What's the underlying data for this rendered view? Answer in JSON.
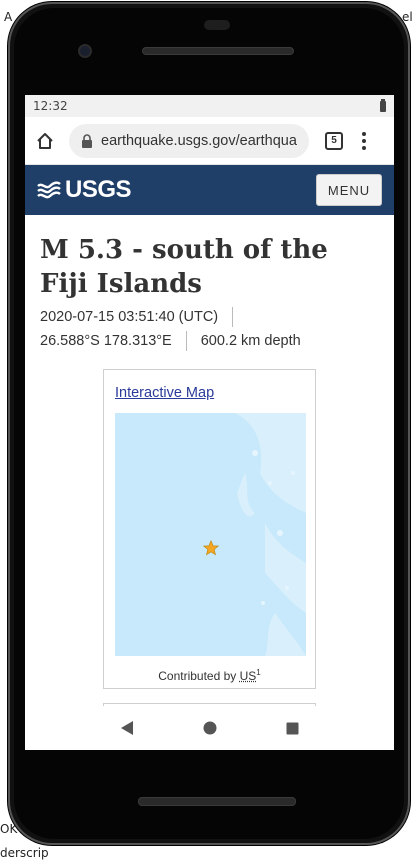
{
  "status_bar": {
    "time": "12:32"
  },
  "browser": {
    "url": "earthquake.usgs.gov/earthqua",
    "tab_count": "5"
  },
  "site_header": {
    "logo_text": "USGS",
    "menu_label": "MENU"
  },
  "event": {
    "title": "M 5.3 - south of the Fiji Islands",
    "time": "2020-07-15 03:51:40 (UTC)",
    "coordinates": "26.588°S 178.313°E",
    "depth": "600.2 km depth"
  },
  "map_card": {
    "link_label": "Interactive Map",
    "contributed_prefix": "Contributed by",
    "contributor": "US",
    "footnote": "1"
  },
  "colors": {
    "header_bg": "#1f3e68",
    "map_water": "#c8e9fb",
    "epicenter_star": "#f5a623",
    "link": "#2a3a9a"
  }
}
